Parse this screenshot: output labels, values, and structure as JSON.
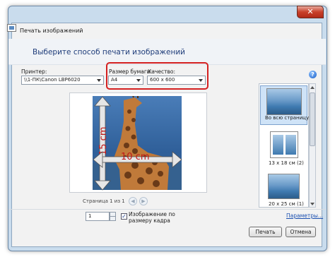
{
  "window": {
    "title": "Печать изображений",
    "close_glyph": "✕"
  },
  "heading": "Выберите способ печати изображений",
  "printer": {
    "label": "Принтер:",
    "value": "\\\\1-ПК\\Canon LBP6020"
  },
  "paper_size": {
    "label": "Размер бумаги:",
    "value": "A4"
  },
  "quality": {
    "label": "Качество:",
    "value": "600 x 600"
  },
  "preview": {
    "annotation_vertical": "15 cm",
    "annotation_horizontal": "10 cm",
    "page_status": "Страница 1 из 1"
  },
  "layouts": [
    {
      "label": "Во всю страницу",
      "selected": true
    },
    {
      "label": "13 x 18 см (2)",
      "selected": false
    },
    {
      "label": "20 x 25 см (1)",
      "selected": false
    }
  ],
  "copies": {
    "value": "1"
  },
  "fit_option": {
    "label_line1": "Изображение по",
    "label_line2": "размеру кадра",
    "checked": true,
    "check_glyph": "✓"
  },
  "options_link": "Параметры...",
  "buttons": {
    "print": "Печать",
    "cancel": "Отмена"
  },
  "help_glyph": "?",
  "colors": {
    "accent_red": "#d42020",
    "heading_blue": "#1f3d7a",
    "link_blue": "#1a4fb0"
  }
}
